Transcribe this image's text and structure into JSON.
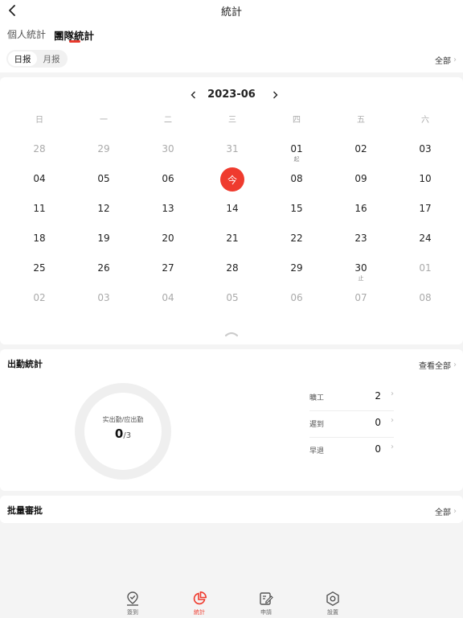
{
  "header": {
    "title": "統計"
  },
  "top_tabs": [
    {
      "label": "個人統計",
      "active": false
    },
    {
      "label": "團隊統計",
      "active": true
    }
  ],
  "filter": {
    "segments": [
      {
        "label": "日报",
        "active": true
      },
      {
        "label": "月报",
        "active": false
      }
    ],
    "all_label": "全部"
  },
  "calendar": {
    "month_label": "2023-06",
    "weekdays": [
      "日",
      "一",
      "二",
      "三",
      "四",
      "五",
      "六"
    ],
    "weeks": [
      [
        {
          "d": "28",
          "other": true
        },
        {
          "d": "29",
          "other": true
        },
        {
          "d": "30",
          "other": true
        },
        {
          "d": "31",
          "other": true
        },
        {
          "d": "01",
          "tag": "起"
        },
        {
          "d": "02"
        },
        {
          "d": "03"
        }
      ],
      [
        {
          "d": "04"
        },
        {
          "d": "05"
        },
        {
          "d": "06"
        },
        {
          "d": "今",
          "today": true
        },
        {
          "d": "08"
        },
        {
          "d": "09"
        },
        {
          "d": "10"
        }
      ],
      [
        {
          "d": "11"
        },
        {
          "d": "12"
        },
        {
          "d": "13"
        },
        {
          "d": "14"
        },
        {
          "d": "15"
        },
        {
          "d": "16"
        },
        {
          "d": "17"
        }
      ],
      [
        {
          "d": "18"
        },
        {
          "d": "19"
        },
        {
          "d": "20"
        },
        {
          "d": "21"
        },
        {
          "d": "22"
        },
        {
          "d": "23"
        },
        {
          "d": "24"
        }
      ],
      [
        {
          "d": "25"
        },
        {
          "d": "26"
        },
        {
          "d": "27"
        },
        {
          "d": "28"
        },
        {
          "d": "29"
        },
        {
          "d": "30",
          "tag": "止"
        },
        {
          "d": "01",
          "other": true
        }
      ],
      [
        {
          "d": "02",
          "other": true
        },
        {
          "d": "03",
          "other": true
        },
        {
          "d": "04",
          "other": true
        },
        {
          "d": "05",
          "other": true
        },
        {
          "d": "06",
          "other": true
        },
        {
          "d": "07",
          "other": true
        },
        {
          "d": "08",
          "other": true
        }
      ]
    ]
  },
  "attendance": {
    "title": "出勤統計",
    "view_all": "查看全部",
    "ring_label": "实出勤/应出勤",
    "actual": "0",
    "expected": "/3",
    "stats": [
      {
        "label": "曠工",
        "value": "2"
      },
      {
        "label": "遲到",
        "value": "0"
      },
      {
        "label": "早退",
        "value": "0"
      }
    ]
  },
  "batch": {
    "title": "批量審批",
    "all_label": "全部"
  },
  "tabbar": [
    {
      "label": "簽到",
      "icon": "checkin-pin-icon",
      "active": false
    },
    {
      "label": "統計",
      "icon": "pie-chart-icon",
      "active": true
    },
    {
      "label": "申請",
      "icon": "edit-form-icon",
      "active": false
    },
    {
      "label": "設置",
      "icon": "settings-hex-icon",
      "active": false
    }
  ],
  "colors": {
    "accent": "#ef3b2e",
    "background": "#f4f4f4"
  }
}
